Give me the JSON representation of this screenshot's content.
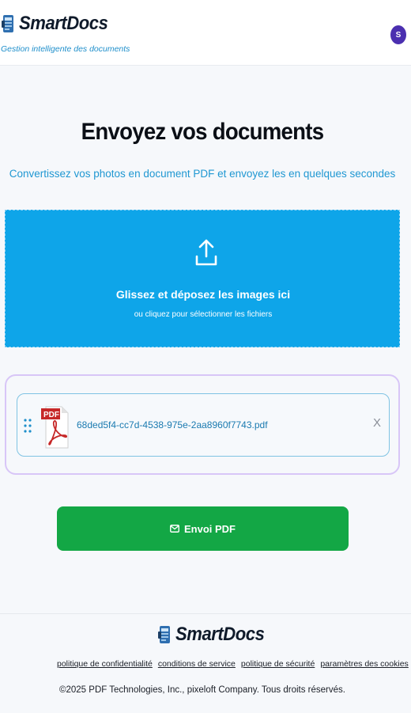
{
  "brand": {
    "name": "SmartDocs",
    "tagline": "Gestion intelligente des documents"
  },
  "user": {
    "avatar_initial": "S"
  },
  "hero": {
    "title": "Envoyez vos documents",
    "subtitle": "Convertissez vos photos en document PDF et envoyez les en quelques secondes"
  },
  "dropzone": {
    "icon": "upload-icon",
    "title": "Glissez et déposez les images ici",
    "subtitle": "ou cliquez pour sélectionner les fichiers"
  },
  "files": [
    {
      "name": "68ded5f4-cc7d-4538-975e-2aa8960f7743.pdf",
      "icon": "pdf-file-icon",
      "remove_label": "X"
    }
  ],
  "actions": {
    "send_label": "Envoi PDF",
    "send_icon": "mail-icon"
  },
  "footer": {
    "links": [
      "politique de confidentialité",
      "conditions de service",
      "politique de sécurité",
      "paramètres des cookies"
    ],
    "copyright": "©2025 PDF Technologies, Inc., pixeloft Company. Tous droits réservés."
  },
  "colors": {
    "accent": "#0ea5e9",
    "send_button": "#13a745",
    "avatar": "#4b2fb0",
    "panel_border": "#d8c6f7"
  }
}
